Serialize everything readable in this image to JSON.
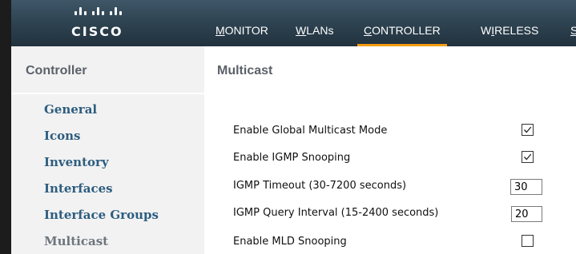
{
  "header": {
    "logo_text": "CISCO",
    "nav": [
      {
        "label": "MONITOR",
        "underline_char": "M",
        "rest": "ONITOR"
      },
      {
        "label": "WLANs",
        "underline_char": "W",
        "rest": "LANs"
      },
      {
        "label": "CONTROLLER",
        "underline_char": "C",
        "rest": "ONTROLLER"
      },
      {
        "label": "WIRELESS",
        "underline_char": "",
        "pre": "W",
        "under": "I",
        "post": "RELESS"
      },
      {
        "label": "S",
        "underline_char": "S",
        "rest": ""
      }
    ],
    "active_nav": "CONTROLLER",
    "active_color": "#f39c12"
  },
  "sidebar": {
    "title": "Controller",
    "items": [
      {
        "label": "General"
      },
      {
        "label": "Icons"
      },
      {
        "label": "Inventory"
      },
      {
        "label": "Interfaces"
      },
      {
        "label": "Interface Groups"
      },
      {
        "label": "Multicast"
      }
    ],
    "active_item": "Multicast"
  },
  "main": {
    "title": "Multicast",
    "fields": [
      {
        "label": "Enable Global Multicast Mode",
        "type": "checkbox",
        "checked": true
      },
      {
        "label": "Enable IGMP Snooping",
        "type": "checkbox",
        "checked": true
      },
      {
        "label": "IGMP Timeout (30-7200 seconds)",
        "type": "text",
        "value": "30"
      },
      {
        "label": "IGMP Query Interval (15-2400 seconds)",
        "type": "text",
        "value": "20"
      },
      {
        "label": "Enable MLD Snooping",
        "type": "checkbox",
        "checked": false
      }
    ]
  },
  "colors": {
    "header_bg": "#2b3f4d",
    "sidebar_bg": "#f2f2f2",
    "sidebar_link": "#2d5d7f",
    "sidebar_active": "#6c757d",
    "title_gray": "#5b6169"
  }
}
